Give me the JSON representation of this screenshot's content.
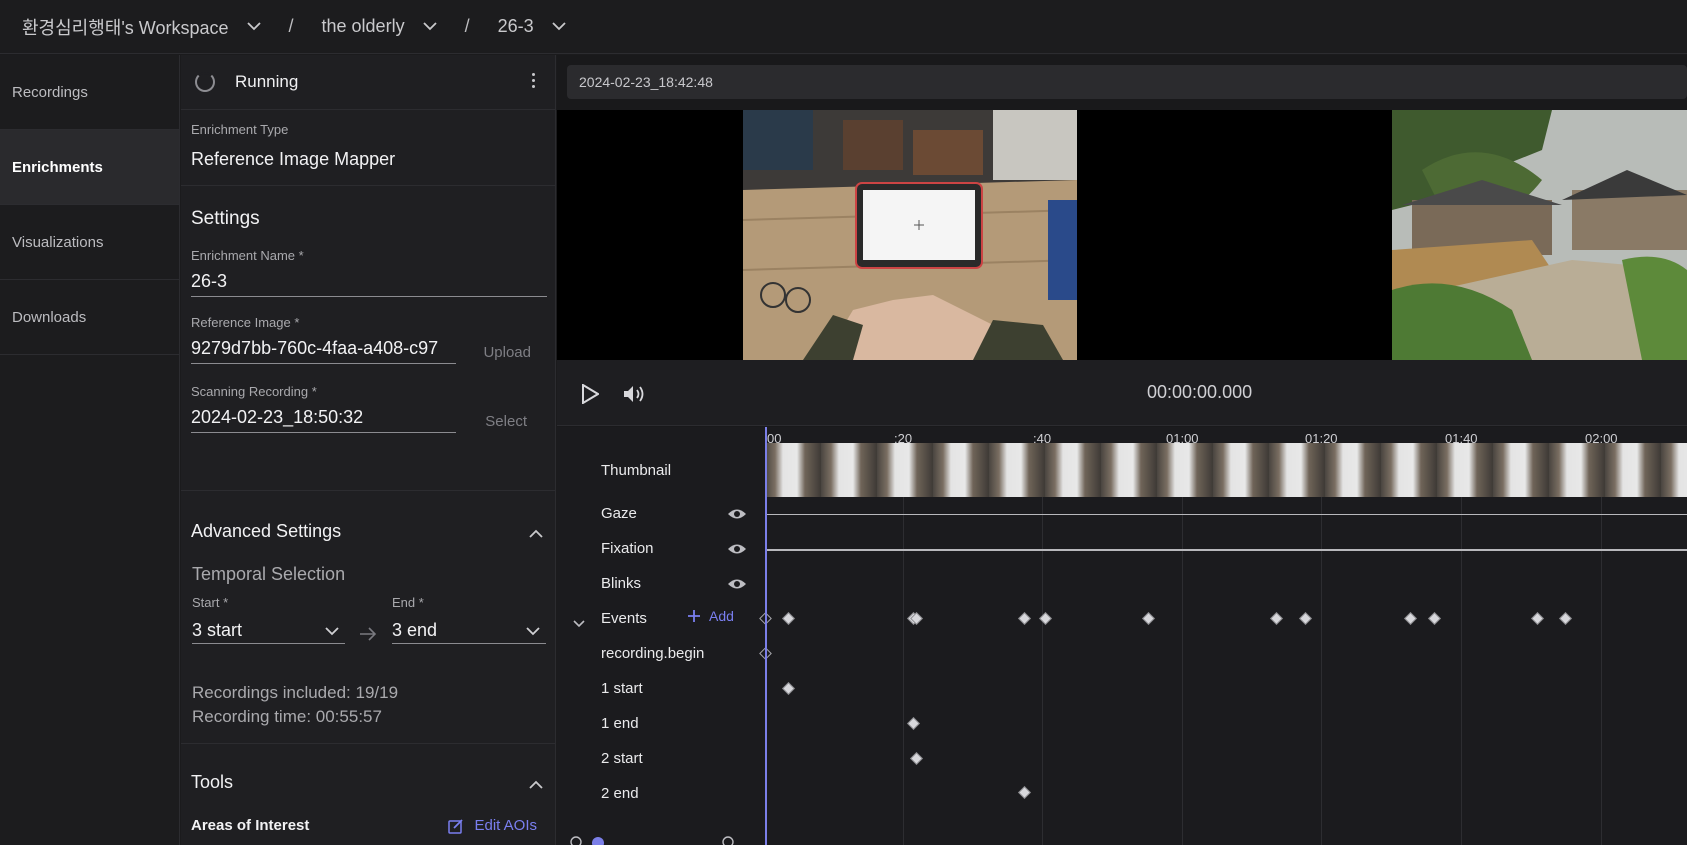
{
  "breadcrumb": {
    "workspace": "환경심리행태's Workspace",
    "project": "the olderly",
    "enrichment": "26-3",
    "separator": "/"
  },
  "nav": {
    "items": [
      {
        "label": "Recordings",
        "active": false
      },
      {
        "label": "Enrichments",
        "active": true
      },
      {
        "label": "Visualizations",
        "active": false
      },
      {
        "label": "Downloads",
        "active": false
      }
    ]
  },
  "panel": {
    "status": "Running",
    "enrichment_type_label": "Enrichment Type",
    "enrichment_type_value": "Reference Image Mapper",
    "settings_title": "Settings",
    "name_label": "Enrichment Name *",
    "name_value": "26-3",
    "ref_image_label": "Reference Image *",
    "ref_image_value": "9279d7bb-760c-4faa-a408-c97",
    "upload_label": "Upload",
    "scan_label": "Scanning Recording *",
    "scan_value": "2024-02-23_18:50:32",
    "select_label": "Select",
    "advanced_title": "Advanced Settings",
    "temporal_title": "Temporal Selection",
    "start_label": "Start *",
    "start_value": "3 start",
    "end_label": "End *",
    "end_value": "3 end",
    "recordings_included": "Recordings included: 19/19",
    "recording_time": "Recording time: 00:55:57",
    "tools_title": "Tools",
    "aoi_label": "Areas of Interest",
    "edit_aoi_label": "Edit AOIs"
  },
  "player": {
    "recording_title": "2024-02-23_18:42:48",
    "timecode": "00:00:00.000"
  },
  "timeline": {
    "ticks": [
      "00",
      ":20",
      ":40",
      "01:00",
      "01:20",
      "01:40",
      "02:00"
    ],
    "tracks": {
      "thumbnail": "Thumbnail",
      "gaze": "Gaze",
      "fixation": "Fixation",
      "blinks": "Blinks",
      "events": "Events",
      "add": "Add"
    },
    "events": [
      "recording.begin",
      "1 start",
      "1 end",
      "2 start",
      "2 end"
    ]
  },
  "colors": {
    "accent": "#7a7ff0",
    "playhead": "#7b7fe8",
    "background": "#1b1b1d"
  }
}
